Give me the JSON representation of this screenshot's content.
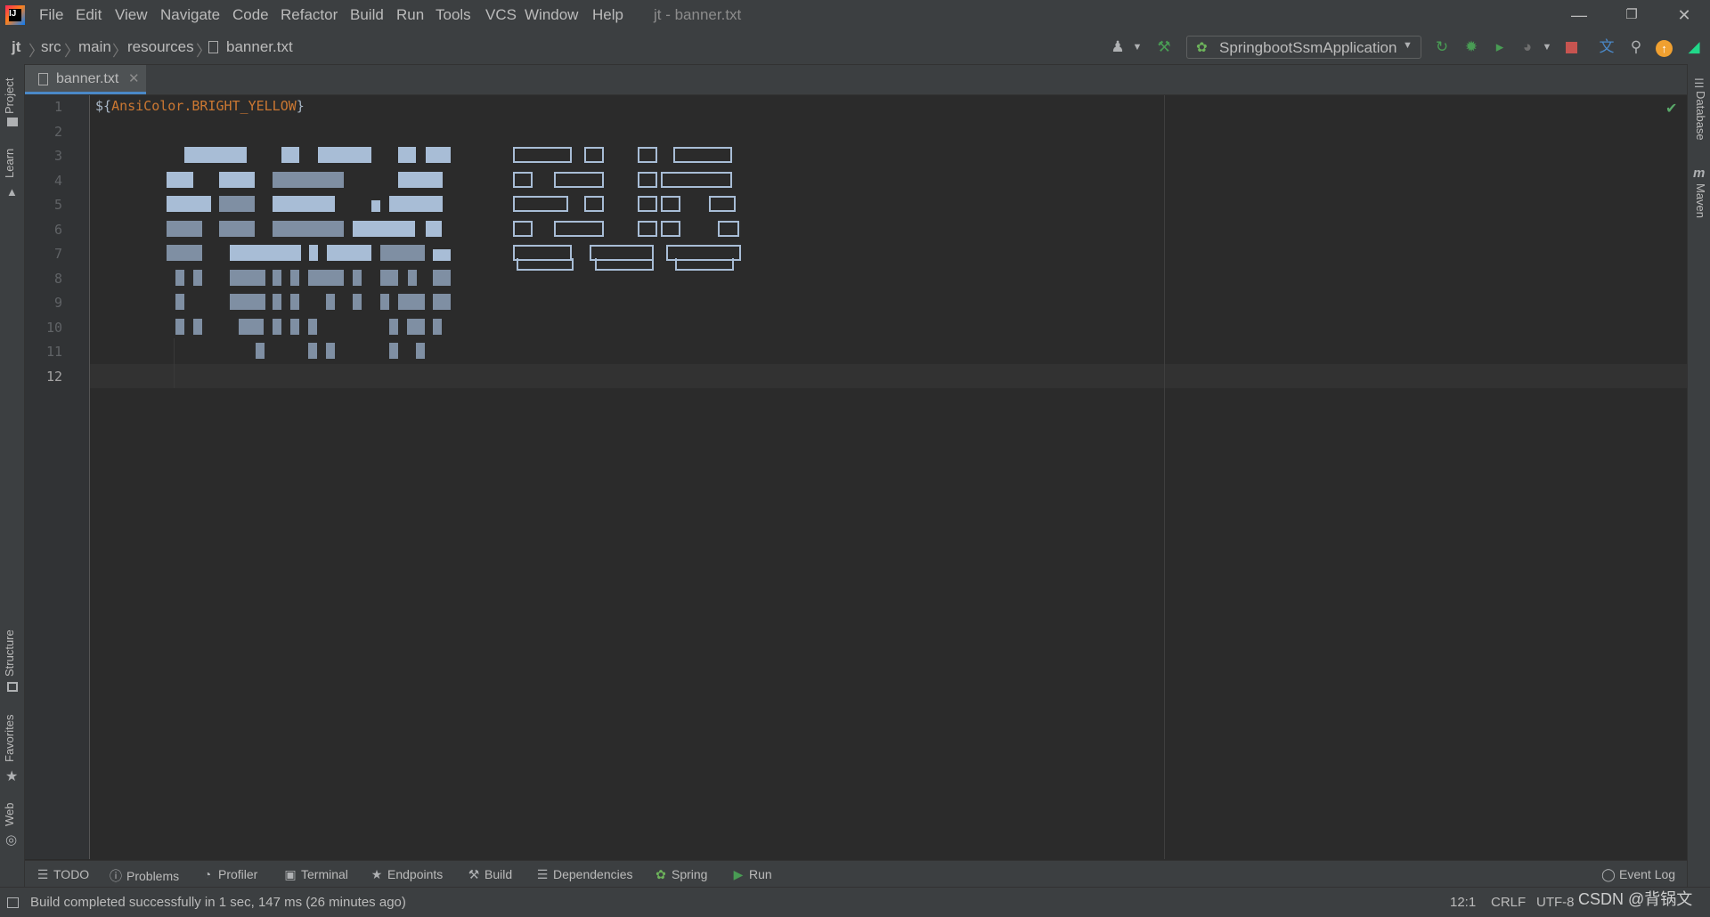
{
  "window": {
    "title": "jt - banner.txt",
    "menu": [
      "File",
      "Edit",
      "View",
      "Navigate",
      "Code",
      "Refactor",
      "Build",
      "Run",
      "Tools",
      "VCS",
      "Window",
      "Help"
    ],
    "controls": [
      "minimize",
      "restore",
      "close"
    ]
  },
  "breadcrumb": [
    "jt",
    "src",
    "main",
    "resources",
    "banner.txt"
  ],
  "toolbar": {
    "run_config": "SpringbootSsmApplication",
    "icons": [
      "user-icon",
      "hammer-icon",
      "rerun-icon",
      "debug-icon",
      "coverage-icon",
      "profile-icon",
      "stop-icon",
      "translate-icon",
      "search-icon",
      "update-icon",
      "toolbox-icon"
    ]
  },
  "left_stripe": [
    "Project",
    "Learn",
    "Structure",
    "Favorites",
    "Web"
  ],
  "right_stripe": [
    "Database",
    "Maven"
  ],
  "editor": {
    "tab": "banner.txt",
    "line_numbers": [
      "1",
      "2",
      "3",
      "4",
      "5",
      "6",
      "7",
      "8",
      "9",
      "10",
      "11",
      "12"
    ],
    "current_line": "12",
    "line1_prefix": "${",
    "line1_ident": "AnsiColor.BRIGHT_YELLOW",
    "line1_suffix": "}"
  },
  "bottom_tools": [
    "TODO",
    "Problems",
    "Profiler",
    "Terminal",
    "Endpoints",
    "Build",
    "Dependencies",
    "Spring",
    "Run",
    "Event Log"
  ],
  "status": {
    "message": "Build completed successfully in 1 sec, 147 ms (26 minutes ago)",
    "position": "12:1",
    "line_separator": "CRLF",
    "encoding": "UTF-8",
    "watermark": "CSDN @背锅文"
  },
  "colors": {
    "keyword": "#cc7832",
    "accent": "#4a88c7",
    "success": "#59a869",
    "ascii_art": "#a8bdd6"
  }
}
